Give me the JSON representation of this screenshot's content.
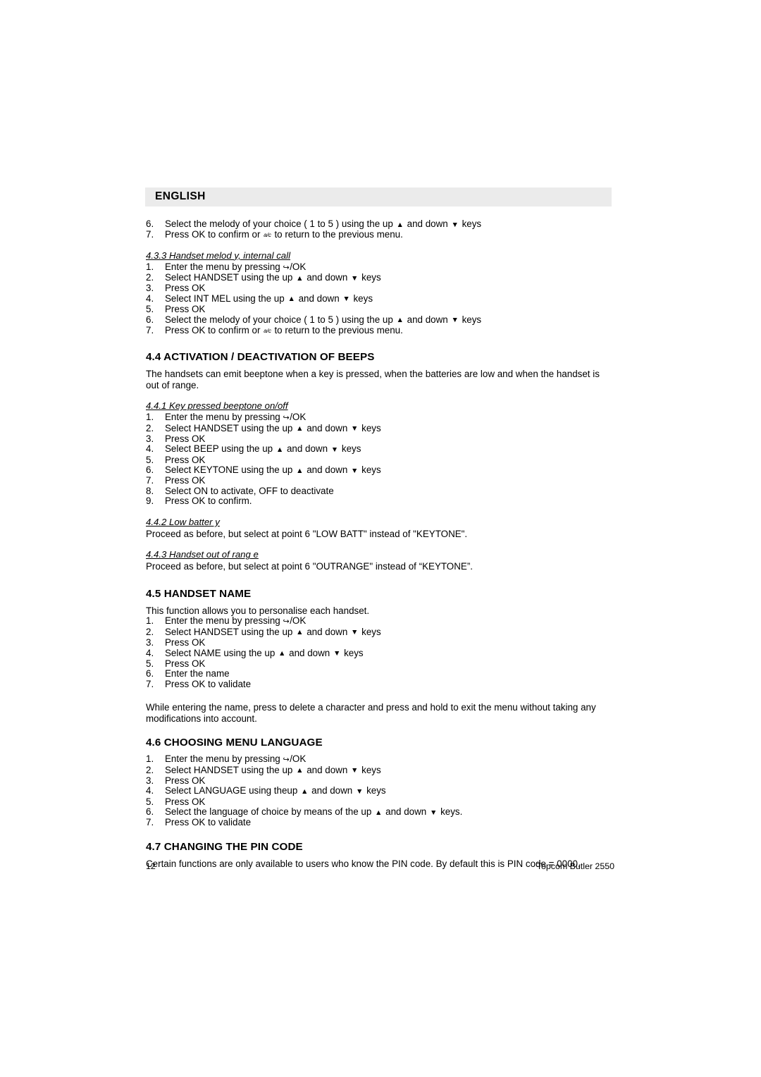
{
  "banner": {
    "language": "ENGLISH"
  },
  "glyphs": {
    "up_arrow": "▲",
    "down_arrow": "▼",
    "menu_key": "↪",
    "clear_key": "a/c"
  },
  "blocks": {
    "top_steps": [
      {
        "num": "6.",
        "pre": "Select the melody of your choice ( 1 to 5 ) using the up ",
        "mid": " and down ",
        "post": " keys",
        "kind": "arrows"
      },
      {
        "num": "7.",
        "pre": "Press OK to confirm or ",
        "mid": "",
        "post": " to return to the previous menu.",
        "kind": "clear"
      }
    ],
    "sec_433": {
      "heading": "4.3.3 Handset melod  y, internal call",
      "steps": [
        {
          "num": "1.",
          "pre": "Enter the menu by pressing  ",
          "post": "/OK",
          "kind": "menu"
        },
        {
          "num": "2.",
          "pre": "Select HANDSET using the up ",
          "mid": " and down ",
          "post": " keys",
          "kind": "arrows"
        },
        {
          "num": "3.",
          "pre": "Press OK",
          "kind": "plain"
        },
        {
          "num": "4.",
          "pre": "Select INT MEL using the up ",
          "mid": " and down ",
          "post": " keys",
          "kind": "arrows"
        },
        {
          "num": "5.",
          "pre": "Press OK",
          "kind": "plain"
        },
        {
          "num": "6.",
          "pre": "Select the melody of your choice ( 1 to 5 ) using the up ",
          "mid": " and down ",
          "post": " keys",
          "kind": "arrows"
        },
        {
          "num": "7.",
          "pre": "Press OK to confirm or ",
          "mid": "",
          "post": " to return to the previous menu.",
          "kind": "clear"
        }
      ]
    },
    "sec_44": {
      "heading": "4.4 ACTIVATION / DEACTIVATION OF BEEPS",
      "intro": "The handsets can emit beeptone when a key is pressed, when the batteries are low and when the handset is out of range.",
      "sub_441": {
        "heading": "4.4.1 Key pressed beeptone on/off",
        "steps": [
          {
            "num": "1.",
            "pre": "Enter the menu by pressing  ",
            "post": "/OK",
            "kind": "menu"
          },
          {
            "num": "2.",
            "pre": "Select HANDSET using the up ",
            "mid": " and down ",
            "post": " keys",
            "kind": "arrows"
          },
          {
            "num": "3.",
            "pre": "Press OK",
            "kind": "plain"
          },
          {
            "num": "4.",
            "pre": "Select BEEP using the up ",
            "mid": " and down ",
            "post": " keys",
            "kind": "arrows"
          },
          {
            "num": "5.",
            "pre": "Press OK",
            "kind": "plain"
          },
          {
            "num": "6.",
            "pre": "Select KEYTONE using the up ",
            "mid": " and down ",
            "post": " keys",
            "kind": "arrows"
          },
          {
            "num": "7.",
            "pre": "Press OK",
            "kind": "plain"
          },
          {
            "num": "8.",
            "pre": "Select ON to activate, OFF to deactivate",
            "kind": "plain"
          },
          {
            "num": "9.",
            "pre": "Press OK to confirm.",
            "kind": "plain"
          }
        ]
      },
      "sub_442": {
        "heading": "4.4.2 Low batter y",
        "body": "Proceed as before, but select at point 6 \"LOW BATT\" instead of \"KEYTONE\"."
      },
      "sub_443": {
        "heading": "4.4.3 Handset out of rang   e",
        "body": "Proceed as before, but select at point 6 \"OUTRANGE\" instead of “KEYTONE”."
      }
    },
    "sec_45": {
      "heading": "4.5 HANDSET NAME",
      "intro": "This function allows you to personalise each handset.",
      "steps": [
        {
          "num": "1.",
          "pre": "Enter the menu by pressing  ",
          "post": "/OK",
          "kind": "menu"
        },
        {
          "num": "2.",
          "pre": "Select HANDSET using the up ",
          "mid": " and down  ",
          "post": " keys",
          "kind": "arrows"
        },
        {
          "num": "3.",
          "pre": "Press OK",
          "kind": "plain"
        },
        {
          "num": "4.",
          "pre": "Select NAME using the up ",
          "mid": " and down ",
          "post": " keys",
          "kind": "arrows"
        },
        {
          "num": "5.",
          "pre": "Press OK",
          "kind": "plain"
        },
        {
          "num": "6.",
          "pre": "Enter the name",
          "kind": "plain"
        },
        {
          "num": "7.",
          "pre": "Press OK to validate",
          "kind": "plain"
        }
      ],
      "outro": "While entering the name, press  to delete a character and press and hold  to exit the menu without taking any modifications into account."
    },
    "sec_46": {
      "heading": "4.6 CHOOSING MENU LANGUAGE",
      "steps": [
        {
          "num": "1.",
          "pre": "Enter the menu by pressing  ",
          "post": "/OK",
          "kind": "menu"
        },
        {
          "num": "2.",
          "pre": "Select HANDSET using the up ",
          "mid": " and down ",
          "post": " keys",
          "kind": "arrows"
        },
        {
          "num": "3.",
          "pre": "Press OK",
          "kind": "plain"
        },
        {
          "num": "4.",
          "pre": "Select LANGUAGE using theup ",
          "mid": " and down ",
          "post": " keys",
          "kind": "arrows"
        },
        {
          "num": "5.",
          "pre": "Press OK",
          "kind": "plain"
        },
        {
          "num": "6.",
          "pre": "Select the language of choice by means of the up ",
          "mid": " and down ",
          "post": " keys.",
          "kind": "arrows"
        },
        {
          "num": "7.",
          "pre": "Press OK to validate",
          "kind": "plain"
        }
      ]
    },
    "sec_47": {
      "heading": "4.7 CHANGING THE PIN CODE",
      "body": "Certain functions are only available to users who know the PIN code. By default this is PIN code = 0000."
    }
  },
  "footer": {
    "page_number": "12",
    "model": "Topcom Butler 2550"
  }
}
